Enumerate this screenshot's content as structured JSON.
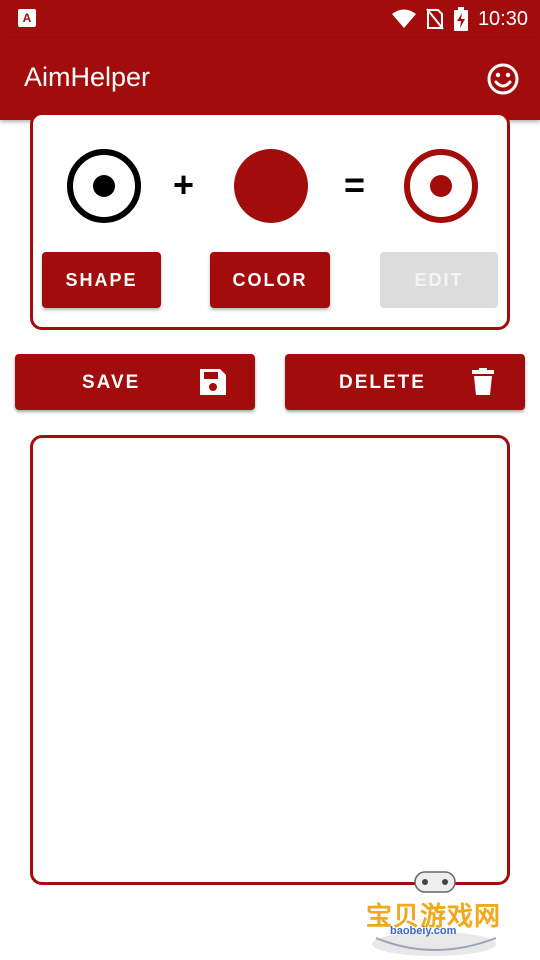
{
  "status_bar": {
    "left_icon": "A",
    "time": "10:30",
    "icons": [
      "wifi-icon",
      "no-sim-icon",
      "battery-charging-icon"
    ]
  },
  "app_bar": {
    "title": "AimHelper",
    "action_icon": "smiley-icon"
  },
  "preview": {
    "plus": "+",
    "equals": "=",
    "shape_button": "SHAPE",
    "color_button": "COLOR",
    "edit_button": "EDIT",
    "colors": {
      "accent": "#a30c0c",
      "shape": "#000000",
      "disabled": "#dcdcdc"
    }
  },
  "actions": {
    "save_label": "SAVE",
    "save_icon": "floppy-disk-icon",
    "delete_label": "DELETE",
    "delete_icon": "trash-icon"
  },
  "saved_list": {
    "items": []
  },
  "watermark": {
    "text": "宝贝游戏网",
    "url": "baobeiy.com"
  }
}
